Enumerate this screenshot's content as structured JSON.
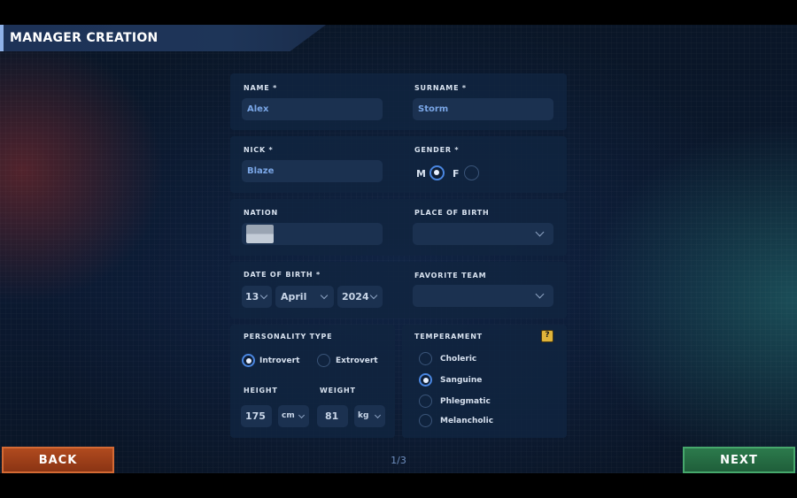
{
  "header": {
    "title": "MANAGER CREATION"
  },
  "form": {
    "name": {
      "label": "NAME *",
      "value": "Alex"
    },
    "surname": {
      "label": "SURNAME *",
      "value": "Storm"
    },
    "nick": {
      "label": "NICK *",
      "value": "Blaze"
    },
    "gender": {
      "label": "GENDER *",
      "options": [
        "M",
        "F"
      ],
      "selected": "M"
    },
    "nation": {
      "label": "NATION",
      "value": ""
    },
    "place_of_birth": {
      "label": "PLACE OF BIRTH",
      "value": ""
    },
    "date_of_birth": {
      "label": "DATE OF BIRTH *",
      "day": "13",
      "month": "April",
      "year": "2024"
    },
    "favorite_team": {
      "label": "FAVORITE TEAM",
      "value": ""
    },
    "personality": {
      "label": "PERSONALITY TYPE",
      "options": [
        "Introvert",
        "Extrovert"
      ],
      "selected": "Introvert"
    },
    "height": {
      "label": "HEIGHT",
      "value": "175",
      "unit": "cm"
    },
    "weight": {
      "label": "WEIGHT",
      "value": "81",
      "unit": "kg"
    },
    "temperament": {
      "label": "TEMPERAMENT",
      "help": "?",
      "options": [
        "Choleric",
        "Sanguine",
        "Phlegmatic",
        "Melancholic"
      ],
      "selected": "Sanguine"
    }
  },
  "footer": {
    "back_label": "BACK",
    "next_label": "NEXT",
    "page": "1/3"
  },
  "colors": {
    "back": "#b04a1e",
    "next": "#2c7a4c",
    "accent": "#4a86e0",
    "help": "#e0b43a"
  }
}
